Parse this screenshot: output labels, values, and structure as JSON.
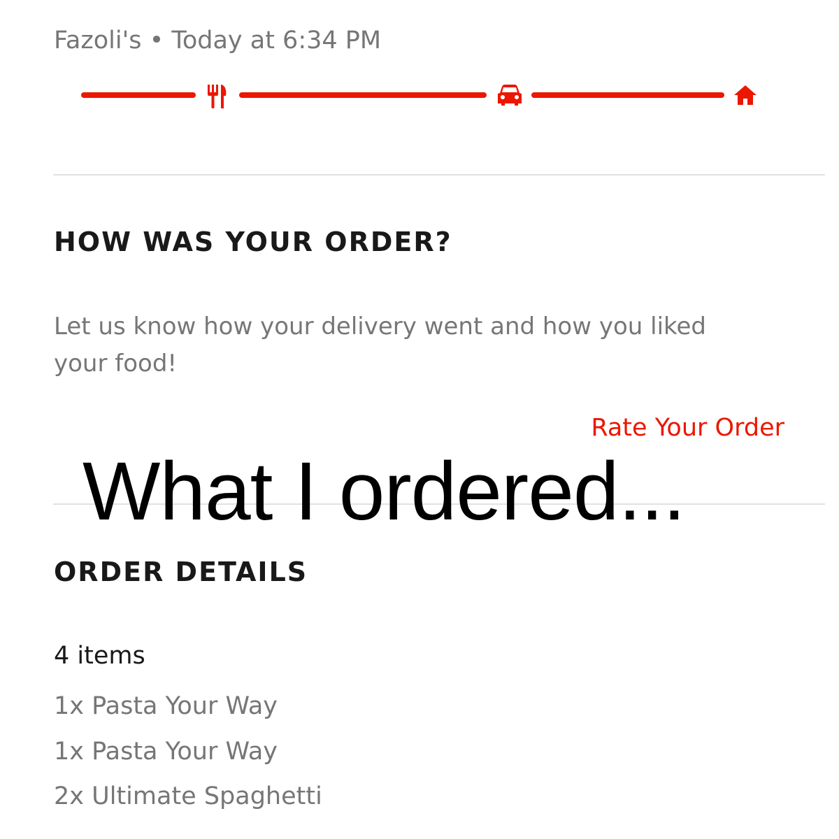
{
  "order_header": {
    "restaurant": "Fazoli's",
    "separator": "•",
    "time": "Today at 6:34 PM"
  },
  "tracker": {
    "status_color": "#eb1700",
    "icons": [
      "utensils-icon",
      "car-icon",
      "home-icon"
    ]
  },
  "rating_section": {
    "heading": "HOW WAS YOUR ORDER?",
    "prompt": "Let us know how your delivery went and how you liked your food!",
    "rate_link": "Rate Your Order"
  },
  "overlay_caption": "What I ordered...",
  "order_details": {
    "heading": "ORDER DETAILS",
    "item_count": "4 items",
    "items": [
      "1x Pasta Your Way",
      "1x Pasta Your Way",
      "2x Ultimate Spaghetti"
    ]
  },
  "colors": {
    "accent": "#eb1700",
    "heading_text": "#191919",
    "secondary_text": "#767676",
    "divider": "#e2e2e2"
  }
}
